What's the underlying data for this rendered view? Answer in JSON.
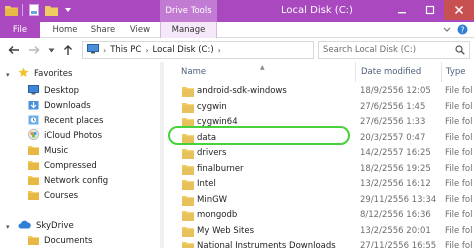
{
  "window": {
    "title": "Local Disk (C:)",
    "context_tab_title": "Drive Tools",
    "controls": {
      "minimize": "—",
      "maximize": "☐",
      "close": "✕"
    }
  },
  "ribbon": {
    "tabs": [
      "File",
      "Home",
      "Share",
      "View",
      "Manage"
    ]
  },
  "address": {
    "crumbs": [
      "This PC",
      "Local Disk (C:)"
    ],
    "search_placeholder": "Search Local Disk (C:)"
  },
  "navigation": {
    "favorites_label": "Favorites",
    "favorites": [
      "Desktop",
      "Downloads",
      "Recent places",
      "iCloud Photos",
      "Music",
      "Compressed",
      "Network config",
      "Courses"
    ],
    "skydrive_label": "SkyDrive",
    "skydrive_items": [
      "Documents"
    ]
  },
  "columns": {
    "name": "Name",
    "date": "Date modified",
    "type": "Type"
  },
  "files": [
    {
      "name": "android-sdk-windows",
      "date": "18/9/2556 12:05",
      "type": "File fol"
    },
    {
      "name": "cygwin",
      "date": "27/6/2556 1:45",
      "type": "File fol"
    },
    {
      "name": "cygwin64",
      "date": "27/6/2556 1:33",
      "type": "File fol"
    },
    {
      "name": "data",
      "date": "20/3/2557 0:47",
      "type": "File fol"
    },
    {
      "name": "drivers",
      "date": "14/2/2557 16:25",
      "type": "File fol"
    },
    {
      "name": "finalburner",
      "date": "18/2/2556 19:25",
      "type": "File fol"
    },
    {
      "name": "Intel",
      "date": "13/2/2556 16:12",
      "type": "File fol"
    },
    {
      "name": "MinGW",
      "date": "29/11/2556 13:34",
      "type": "File fol"
    },
    {
      "name": "mongodb",
      "date": "8/12/2556 16:36",
      "type": "File fol"
    },
    {
      "name": "My Web Sites",
      "date": "13/2/2556 20:01",
      "type": "File fol"
    },
    {
      "name": "National Instruments Downloads",
      "date": "27/11/2556 16:55",
      "type": "File fol"
    }
  ],
  "highlighted_file": "data",
  "colors": {
    "title_bar": "#a948bf",
    "context_tab": "#c27bd2",
    "highlight_ring": "#47d13a",
    "folder": "#e8c15a"
  }
}
